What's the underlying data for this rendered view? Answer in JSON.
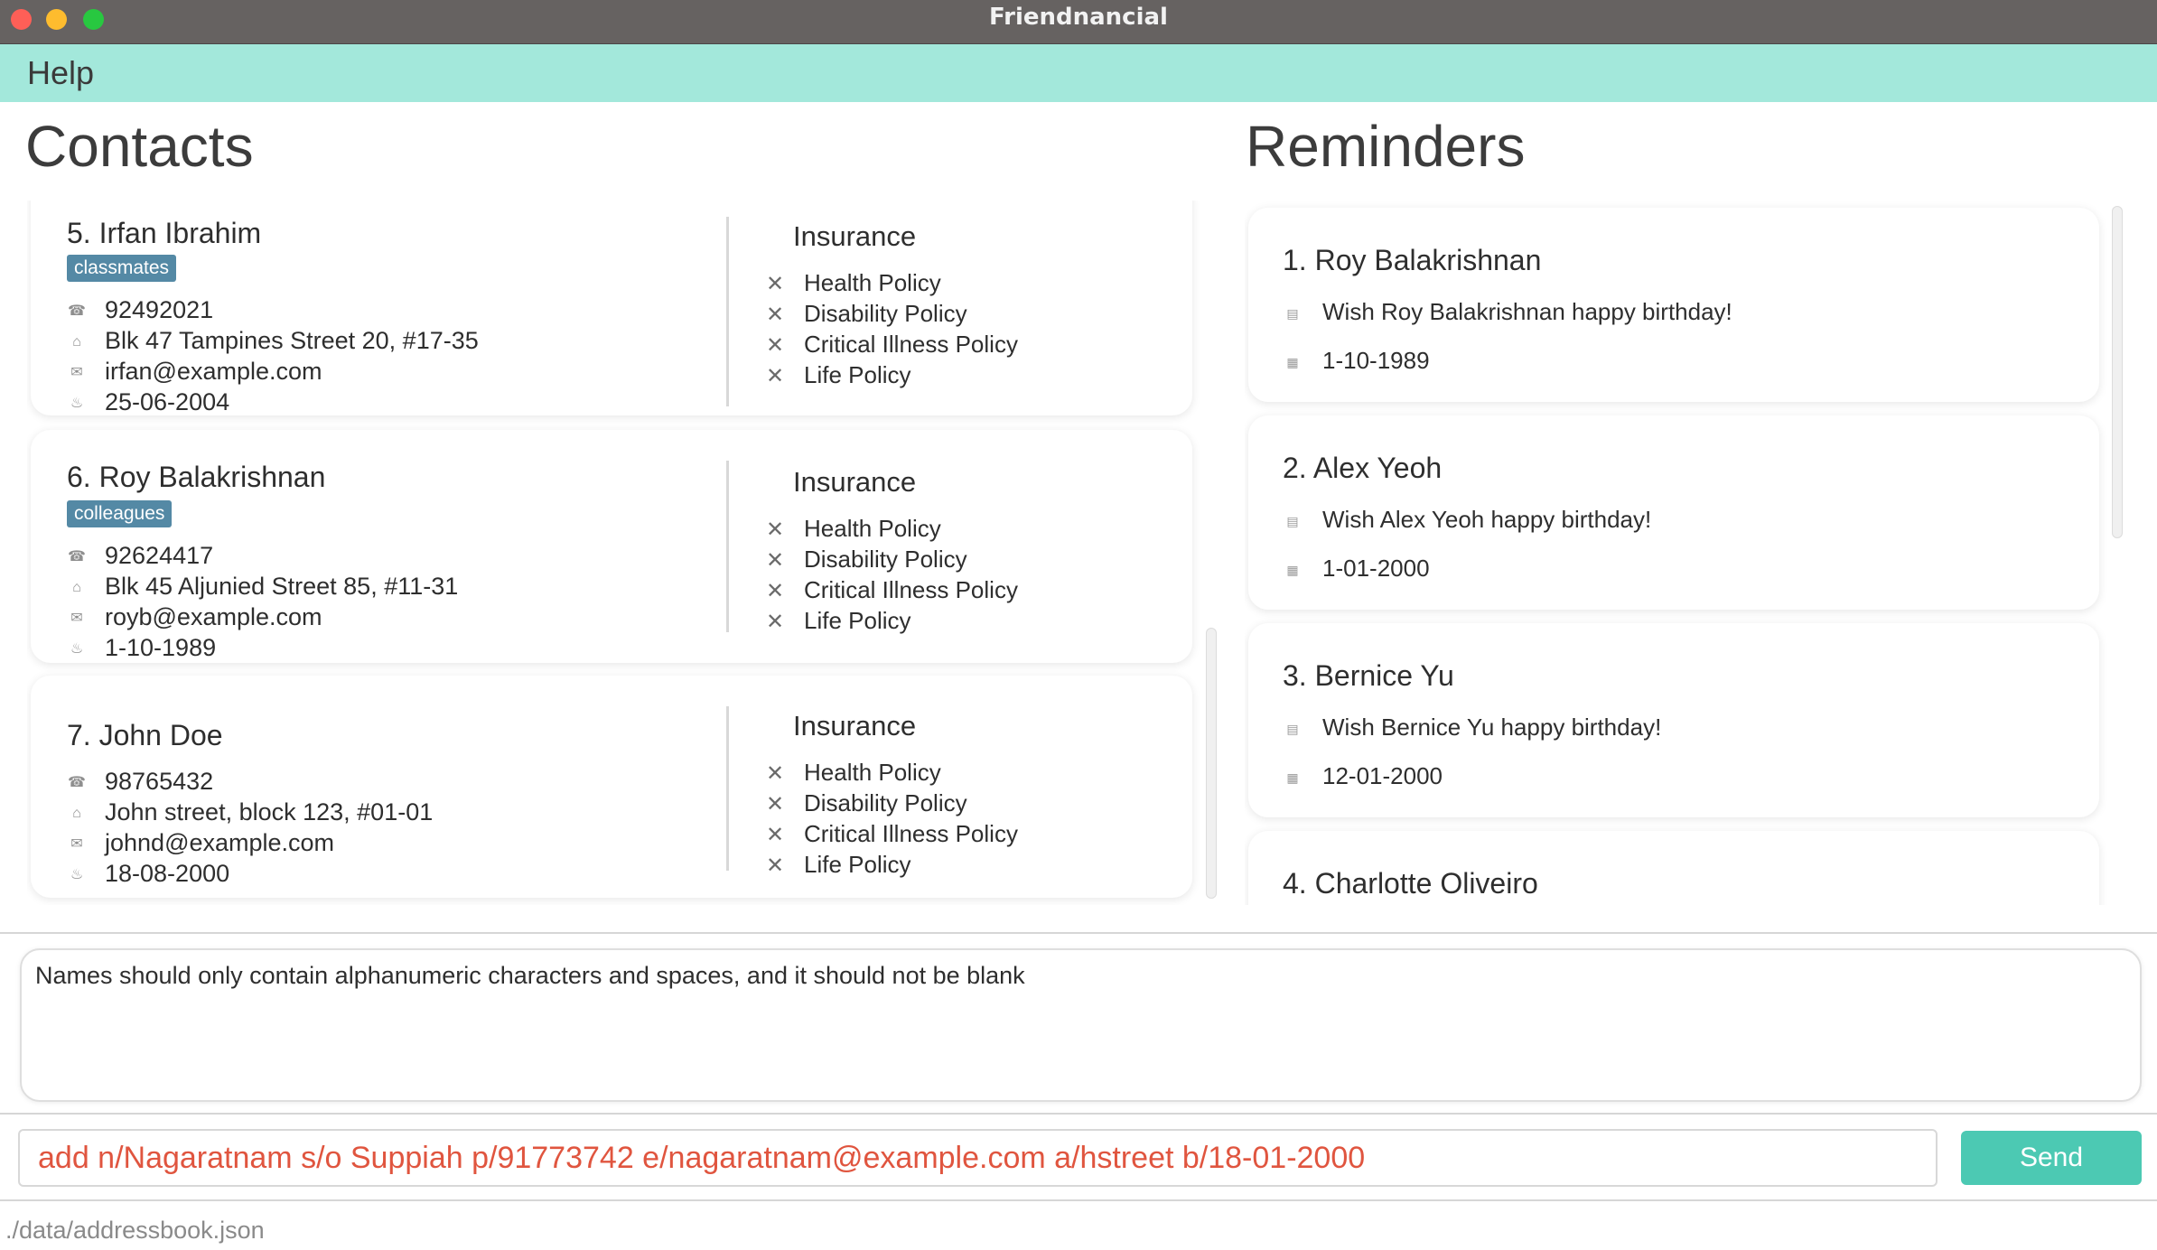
{
  "window": {
    "title": "Friendnancial"
  },
  "menu": {
    "help": "Help"
  },
  "contacts": {
    "title": "Contacts",
    "insurance_heading": "Insurance",
    "items": [
      {
        "name": "5.  Irfan Ibrahim",
        "tag": "classmates",
        "phone": "92492021",
        "address": "Blk 47 Tampines Street 20, #17-35",
        "email": "irfan@example.com",
        "birthday": "25-06-2004",
        "policies": [
          "Health Policy",
          "Disability Policy",
          "Critical Illness Policy",
          "Life Policy"
        ]
      },
      {
        "name": "6.  Roy Balakrishnan",
        "tag": "colleagues",
        "phone": "92624417",
        "address": "Blk 45 Aljunied Street 85, #11-31",
        "email": "royb@example.com",
        "birthday": "1-10-1989",
        "policies": [
          "Health Policy",
          "Disability Policy",
          "Critical Illness Policy",
          "Life Policy"
        ]
      },
      {
        "name": "7.  John Doe",
        "phone": "98765432",
        "address": "John street, block 123, #01-01",
        "email": "johnd@example.com",
        "birthday": "18-08-2000",
        "policies": [
          "Health Policy",
          "Disability Policy",
          "Critical Illness Policy",
          "Life Policy"
        ]
      }
    ]
  },
  "reminders": {
    "title": "Reminders",
    "items": [
      {
        "name": "1.  Roy Balakrishnan",
        "message": "Wish Roy Balakrishnan happy birthday!",
        "date": "1-10-1989"
      },
      {
        "name": "2.  Alex Yeoh",
        "message": "Wish Alex Yeoh happy birthday!",
        "date": "1-01-2000"
      },
      {
        "name": "3.  Bernice Yu",
        "message": "Wish Bernice Yu happy birthday!",
        "date": "12-01-2000"
      },
      {
        "name": "4.  Charlotte Oliveiro"
      }
    ]
  },
  "result": {
    "text": "Names should only contain alphanumeric characters and spaces, and it should not be blank"
  },
  "command": {
    "value": "add n/Nagaratnam s/o Suppiah p/91773742 e/nagaratnam@example.com a/hstreet b/18-01-2000",
    "send_label": "Send"
  },
  "status": {
    "path": "./data/addressbook.json"
  },
  "colors": {
    "menu_bar": "#a3e8db",
    "tag": "#5489a5",
    "send_button": "#4cc9b3",
    "command_text": "#e0553f"
  }
}
